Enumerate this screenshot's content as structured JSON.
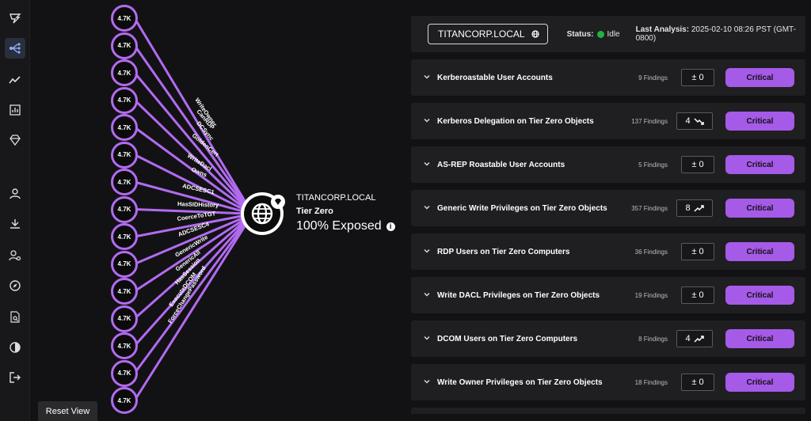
{
  "sidebar": {
    "icons": [
      "logo-icon",
      "attack-paths-icon",
      "trend-icon",
      "bar-chart-icon",
      "gem-icon",
      "user-icon",
      "download-icon",
      "user-settings-icon",
      "compass-icon",
      "file-search-icon",
      "contrast-icon",
      "logout-icon"
    ]
  },
  "graph": {
    "node_label": "4.7K",
    "edges": [
      "WriteOwner",
      "CanRDP",
      "DCSync",
      "GoldenCert",
      "WriteDacl",
      "Owns",
      "ADCSESC1",
      "HasSIDHistory",
      "CoerceToTGT",
      "ADCSESC4",
      "GenericWrite",
      "GenericAll",
      "HasSession",
      "ExecuteDCOM",
      "ForceChangePassword"
    ],
    "center": {
      "title": "TITANCORP.LOCAL",
      "subtitle": "Tier Zero",
      "exposed": "100% Exposed"
    },
    "reset_label": "Reset View"
  },
  "header": {
    "domain": "TITANCORP.LOCAL",
    "status_label": "Status:",
    "status_value": "Idle",
    "last_label": "Last Analysis:",
    "last_value": "2025-02-10 08:26 PST (GMT-0800)"
  },
  "findings": [
    {
      "name": "Kerberoastable User Accounts",
      "count": "9 Findings",
      "change": "± 0",
      "trend": "none",
      "severity": "Critical"
    },
    {
      "name": "Kerberos Delegation on Tier Zero Objects",
      "count": "137 Findings",
      "change": "4",
      "trend": "down",
      "severity": "Critical"
    },
    {
      "name": "AS-REP Roastable User Accounts",
      "count": "5 Findings",
      "change": "± 0",
      "trend": "none",
      "severity": "Critical"
    },
    {
      "name": "Generic Write Privileges on Tier Zero Objects",
      "count": "357 Findings",
      "change": "8",
      "trend": "up",
      "severity": "Critical"
    },
    {
      "name": "RDP Users on Tier Zero Computers",
      "count": "36 Findings",
      "change": "± 0",
      "trend": "none",
      "severity": "Critical"
    },
    {
      "name": "Write DACL Privileges on Tier Zero Objects",
      "count": "19 Findings",
      "change": "± 0",
      "trend": "none",
      "severity": "Critical"
    },
    {
      "name": "DCOM Users on Tier Zero Computers",
      "count": "8 Findings",
      "change": "4",
      "trend": "up",
      "severity": "Critical"
    },
    {
      "name": "Write Owner Privileges on Tier Zero Objects",
      "count": "18 Findings",
      "change": "± 0",
      "trend": "none",
      "severity": "Critical"
    }
  ],
  "colors": {
    "accent": "#a65ae8",
    "node_ring": "#b26bf0",
    "status_ok": "#1fb33e"
  }
}
